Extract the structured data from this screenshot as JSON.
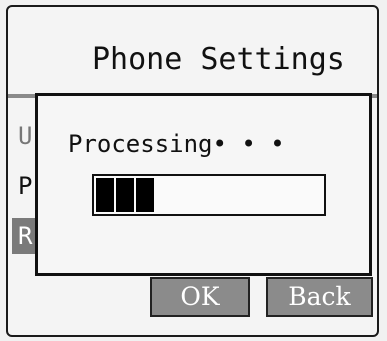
{
  "screen": {
    "title": "Phone Settings"
  },
  "menu": {
    "items": [
      {
        "label": "U",
        "state": "dim"
      },
      {
        "label": "P",
        "state": "normal"
      },
      {
        "label": "R",
        "state": "selected"
      }
    ]
  },
  "dialog": {
    "message": "Processing• • •",
    "progress_segments_filled": 3
  },
  "softkeys": {
    "ok_label": "OK",
    "back_label": "Back"
  },
  "colors": {
    "selected_bg": "#7a7a7a",
    "softkey_bg": "#8b8b8b",
    "progress_fill": "#000000"
  }
}
